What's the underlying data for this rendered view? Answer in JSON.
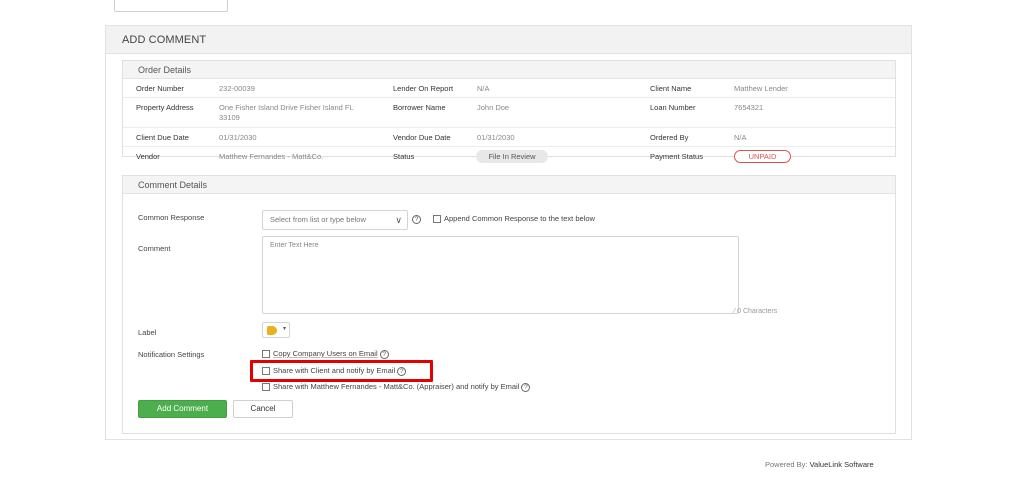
{
  "panel": {
    "title": "ADD COMMENT"
  },
  "order_details": {
    "title": "Order Details",
    "order_number_label": "Order Number",
    "order_number": "232-00039",
    "lender_on_report_label": "Lender On Report",
    "lender_on_report": "N/A",
    "client_name_label": "Client Name",
    "client_name": "Matthew Lender",
    "property_address_label": "Property Address",
    "property_address_line1": "One Fisher Island Drive Fisher Island FL",
    "property_address_line2": "33109",
    "borrower_name_label": "Borrower Name",
    "borrower_name": "John Doe",
    "loan_number_label": "Loan Number",
    "loan_number": "7654321",
    "client_due_date_label": "Client Due Date",
    "client_due_date": "01/31/2030",
    "vendor_due_date_label": "Vendor Due Date",
    "vendor_due_date": "01/31/2030",
    "ordered_by_label": "Ordered By",
    "ordered_by": "N/A",
    "vendor_label": "Vendor",
    "vendor": "Matthew Fernandes - Matt&Co.",
    "status_label": "Status",
    "status": "File In Review",
    "payment_status_label": "Payment Status",
    "payment_status": "UNPAID"
  },
  "comment_details": {
    "title": "Comment Details",
    "common_response_label": "Common Response",
    "common_response_placeholder": "Select from list or type below",
    "append_label": "Append Common Response to the text below",
    "comment_label": "Comment",
    "comment_placeholder": "Enter Text Here",
    "char_count": "0 Characters",
    "label_label": "Label",
    "notification_label": "Notification Settings",
    "notify_company_users": "Copy Company Users on Email",
    "notify_client": "Share with Client and notify by Email",
    "notify_appraiser": "Share with Matthew Fernandes - Matt&Co. (Appraiser) and notify by Email",
    "add_button": "Add Comment",
    "cancel_button": "Cancel"
  },
  "footer": {
    "powered_by": "Powered By: ",
    "brand": "ValueLink Software"
  },
  "colors": {
    "accent_green": "#4cae4c",
    "unpaid_red": "#d9534f",
    "highlight_red": "#e30000"
  },
  "icons": [
    "help-icon",
    "chevron-down-icon",
    "tag-icon",
    "caret-down-icon",
    "resize-icon"
  ]
}
